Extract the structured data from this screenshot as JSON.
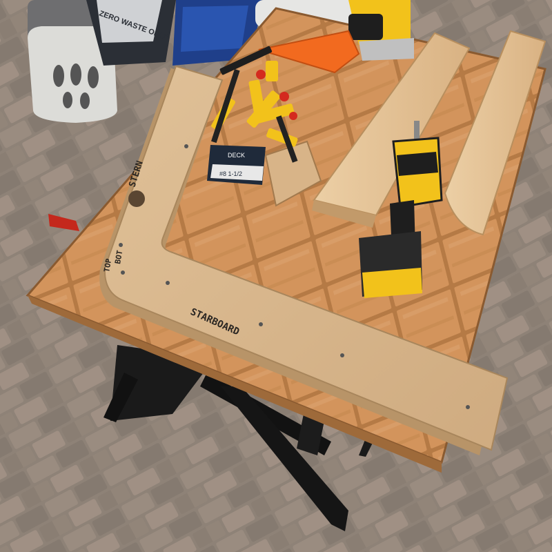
{
  "labels": {
    "stern": "STERN",
    "starboard": "STARBOARD",
    "top_mark": "TOP",
    "bot_mark": "BOT",
    "bin_text": "ZERO WASTE ONLY",
    "box_text": "#8 1-1/2",
    "box_brand": "DECK"
  },
  "colors": {
    "pavers": "#8c7f74",
    "table_wood": "#c98b55",
    "mdf": "#d9b88f",
    "lumber": "#e8c89c",
    "tool_yellow": "#f2c21b",
    "tool_black": "#1e1e1e",
    "square_orange": "#f26a1f"
  },
  "icons": [
    "propane-tank",
    "recycle-bin",
    "jigsaw",
    "speed-square",
    "bar-clamps",
    "screw-box",
    "impact-driver",
    "workbench-stand"
  ]
}
